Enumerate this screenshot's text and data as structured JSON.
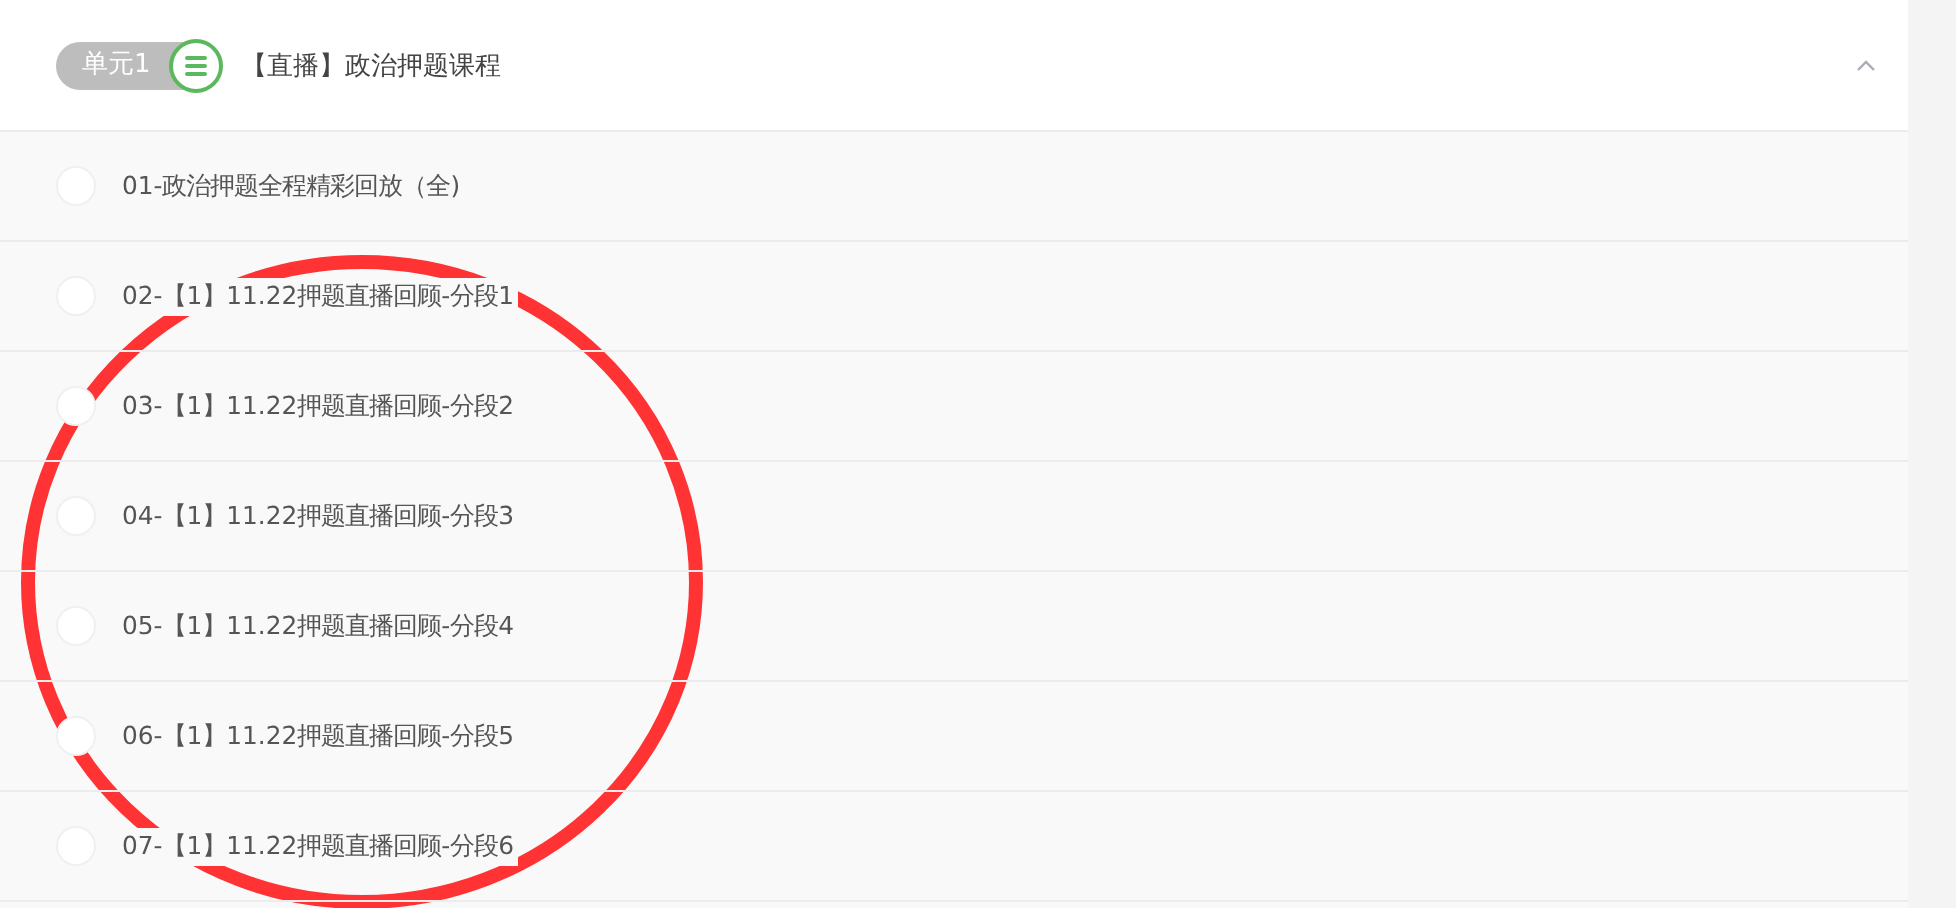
{
  "unit": {
    "badge": "单元1",
    "title": "【直播】政治押题课程",
    "expanded": true
  },
  "lessons": [
    {
      "title": "01-政治押题全程精彩回放（全)"
    },
    {
      "title": "02-【1】11.22押题直播回顾-分段1"
    },
    {
      "title": "03-【1】11.22押题直播回顾-分段2"
    },
    {
      "title": "04-【1】11.22押题直播回顾-分段3"
    },
    {
      "title": "05-【1】11.22押题直播回顾-分段4"
    },
    {
      "title": "06-【1】11.22押题直播回顾-分段5"
    },
    {
      "title": "07-【1】11.22押题直播回顾-分段6"
    }
  ]
}
